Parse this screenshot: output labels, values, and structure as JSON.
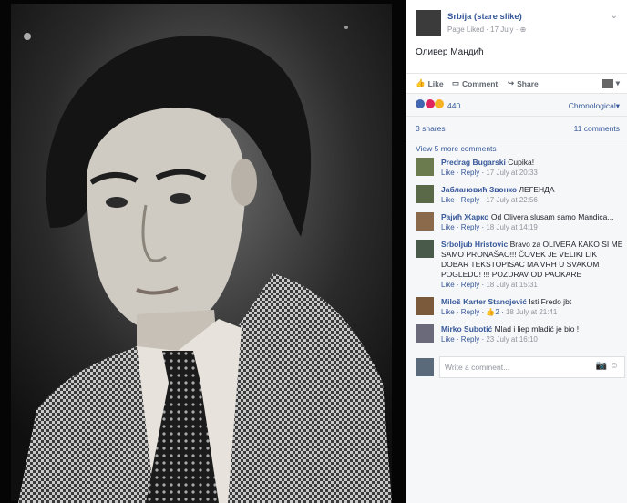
{
  "post": {
    "page_name": "Srbija (stare slike)",
    "page_liked": "Page Liked",
    "date": "17 July",
    "text": "Оливер Мандић"
  },
  "actions": {
    "like": "Like",
    "comment": "Comment",
    "share": "Share"
  },
  "reactions": {
    "count": "440",
    "sort": "Chronological"
  },
  "stats": {
    "shares": "3 shares",
    "comments": "11 comments"
  },
  "view_more": "View 5 more comments",
  "comments": [
    {
      "author": "Predrag Bugarski",
      "text": "Cupika!",
      "like": "Like",
      "reply": "Reply",
      "time": "17 July at 20:33"
    },
    {
      "author": "Јаблановић Звонко",
      "text": "ЛЕГЕНДА",
      "like": "Like",
      "reply": "Reply",
      "time": "17 July at 22:56"
    },
    {
      "author": "Рајић Жарко",
      "text": "Od Olivera slusam samo Mandica...",
      "like": "Like",
      "reply": "Reply",
      "time": "18 July at 14:19"
    },
    {
      "author": "Srboljub Hristovic",
      "text": "Bravo za OLIVERA KAKO SI ME SAMO PRONAŠAO!!! ČOVEK JE VELIKI LIK DOBAR TEKSTOPISAC MA VRH U SVAKOM POGLEDU! !!! POZDRAV OD PAOKARE",
      "like": "Like",
      "reply": "Reply",
      "time": "18 July at 15:31"
    },
    {
      "author": "Miloš Karter Stanojević",
      "text": "Isti Fredo jbt",
      "like": "Like",
      "reply": "Reply",
      "likes": "2",
      "time": "18 July at 21:41"
    },
    {
      "author": "Mirko Subotić",
      "text": "Mlad i liep mladić je bio !",
      "like": "Like",
      "reply": "Reply",
      "time": "23 July at 16:10"
    }
  ],
  "write_placeholder": "Write a comment...",
  "icons": [
    "globe-icon",
    "like-icon",
    "comment-icon",
    "share-icon",
    "chevron-down-icon",
    "camera-icon",
    "emoji-icon"
  ]
}
